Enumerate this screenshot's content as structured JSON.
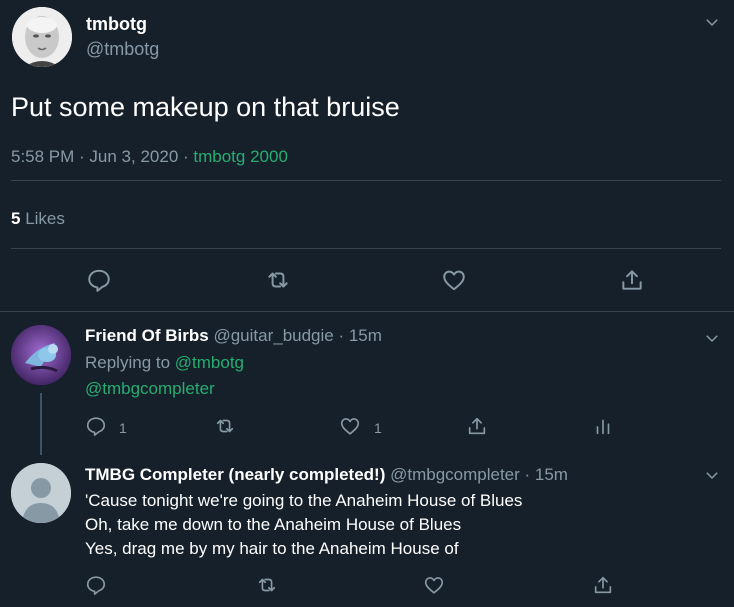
{
  "main_tweet": {
    "display_name": "tmbotg",
    "handle": "@tmbotg",
    "text": "Put some makeup on that bruise",
    "time_date": "5:58 PM · Jun 3, 2020 · ",
    "source": "tmbotg 2000",
    "likes_count": "5",
    "likes_label": " Likes"
  },
  "reply_1": {
    "display_name": "Friend Of Birbs",
    "handle_time": " @guitar_budgie · 15m",
    "replying_to_label": "Replying to ",
    "replying_to_handle": "@tmbotg",
    "text": "@tmbgcompleter",
    "reply_count": "1",
    "like_count": "1"
  },
  "reply_2": {
    "display_name": "TMBG Completer (nearly completed!)",
    "handle_time": " @tmbgcompleter · 15m",
    "line_1": "'Cause tonight we're going to the Anaheim House of Blues",
    "line_2": "Oh, take me down to the Anaheim House of Blues",
    "line_3": "Yes, drag me by my hair to the Anaheim House of"
  },
  "icons": [
    "chevron-down-icon",
    "reply-icon",
    "retweet-icon",
    "like-icon",
    "share-icon",
    "analytics-icon",
    "default-avatar-icon"
  ],
  "colors": {
    "background": "#15202b",
    "accent": "#27ad70",
    "muted": "#8899a6",
    "divider": "#38444d"
  }
}
